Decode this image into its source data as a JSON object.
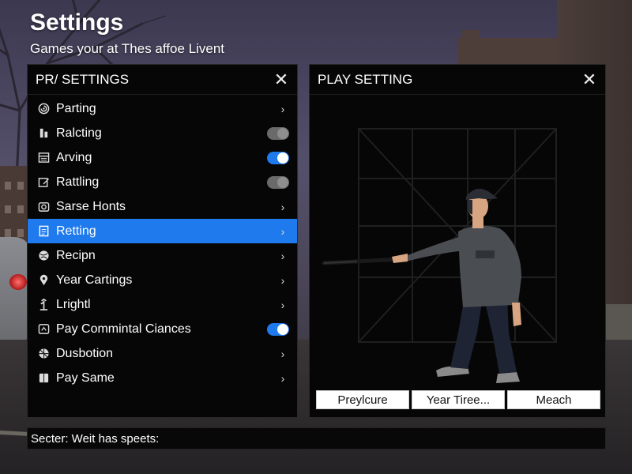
{
  "header": {
    "title": "Settings",
    "subtitle": "Games your at Thes affoe Livent"
  },
  "left_panel": {
    "title": "PR/ SETTINGS",
    "close_glyph": "✕",
    "items": [
      {
        "label": "Parting",
        "icon": "spiral-icon",
        "control": "chevron"
      },
      {
        "label": "Ralcting",
        "icon": "bar-icon",
        "control": "toggle",
        "state": "off"
      },
      {
        "label": "Arving",
        "icon": "grid-icon",
        "control": "toggle",
        "state": "on"
      },
      {
        "label": "Rattling",
        "icon": "edit-icon",
        "control": "toggle",
        "state": "off"
      },
      {
        "label": "Sarse Honts",
        "icon": "camera-icon",
        "control": "chevron"
      },
      {
        "label": "Retting",
        "icon": "document-icon",
        "control": "chevron",
        "selected": true
      },
      {
        "label": "Recipn",
        "icon": "globe-icon",
        "control": "chevron"
      },
      {
        "label": "Year Cartings",
        "icon": "location-pin-icon",
        "control": "chevron"
      },
      {
        "label": "Lrightl",
        "icon": "lift-icon",
        "control": "chevron"
      },
      {
        "label": "Pay Commintal Ciances",
        "icon": "chat-icon",
        "control": "toggle",
        "state": "on"
      },
      {
        "label": "Dusbotion",
        "icon": "ball-icon",
        "control": "chevron"
      },
      {
        "label": "Pay Same",
        "icon": "book-icon",
        "control": "chevron"
      }
    ]
  },
  "right_panel": {
    "title": "PLAY SETTING",
    "close_glyph": "✕",
    "buttons": [
      "Preylcure",
      "Year Tiree...",
      "Meach"
    ]
  },
  "status": {
    "text": "Secter: Weit has speets:"
  },
  "colors": {
    "accent": "#1f7aed",
    "panel_bg": "#060606",
    "toggle_off": "#6a6a6a"
  }
}
